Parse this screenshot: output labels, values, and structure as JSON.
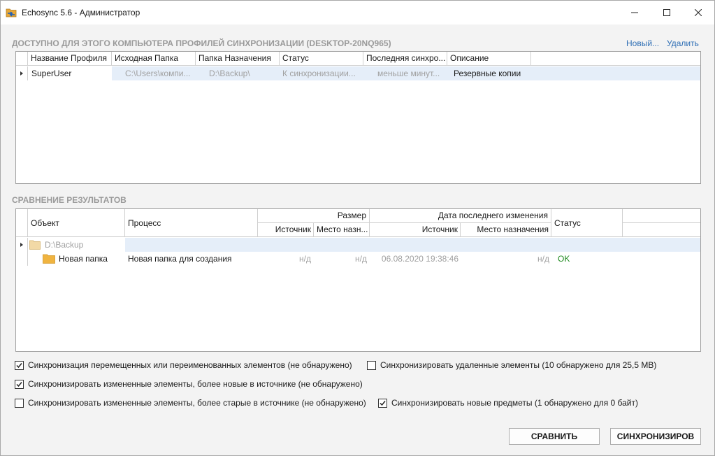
{
  "window": {
    "title": "Echosync 5.6 - Администратор"
  },
  "profiles": {
    "section_title": "ДОСТУПНО ДЛЯ ЭТОГО КОМПЬЮТЕРА ПРОФИЛЕЙ СИНХРОНИЗАЦИИ (DESKTOP-20NQ965)",
    "new_link": "Новый...",
    "delete_link": "Удалить",
    "columns": [
      "Название Профиля",
      "Исходная Папка",
      "Папка Назначения",
      "Статус",
      "Последняя синхро...",
      "Описание"
    ],
    "rows": [
      {
        "name": "SuperUser",
        "source": "C:\\Users\\компи...",
        "destination": "D:\\Backup\\",
        "status": "К синхронизации...",
        "last_sync": "меньше минут...",
        "description": "Резервные копии"
      }
    ]
  },
  "compare": {
    "section_title": "СРАВНЕНИЕ РЕЗУЛЬТАТОВ",
    "col_object": "Объект",
    "col_process": "Процесс",
    "col_size": "Размер",
    "col_date": "Дата последнего изменения",
    "col_status": "Статус",
    "sub_source": "Источник",
    "sub_dest_short": "Место назн...",
    "sub_source2": "Источник",
    "sub_dest": "Место назначения",
    "root_row": {
      "object": "D:\\Backup"
    },
    "rows": [
      {
        "object": "Новая папка",
        "process": "Новая папка для создания",
        "size_source": "н/д",
        "size_dest": "н/д",
        "date_source": "06.08.2020 19:38:46",
        "date_dest": "н/д",
        "status": "OK"
      }
    ]
  },
  "options": {
    "moved": {
      "label": "Синхронизация перемещенных или переименованных элементов (не обнаружено)",
      "checked": true
    },
    "deleted": {
      "label": "Синхронизировать удаленные элементы (10 обнаружено для 25,5 MB)",
      "checked": false
    },
    "newer": {
      "label": "Синхронизировать измененные элементы, более новые в источнике (не обнаружено)",
      "checked": true
    },
    "older": {
      "label": "Синхронизировать измененные элементы, более старые в источнике (не обнаружено)",
      "checked": false
    },
    "new_items": {
      "label": "Синхронизировать новые предметы (1 обнаружено для 0 байт)",
      "checked": true
    }
  },
  "buttons": {
    "compare": "СРАВНИТЬ",
    "sync": "СИНХРОНИЗИРОВ"
  },
  "colors": {
    "link": "#2f6fb5",
    "selected_row": "#e5eef9",
    "ok": "#1e8a1e",
    "section_title": "#9a9a9a"
  },
  "icons": {
    "app": "folder-sync-icon",
    "folder": "folder-icon",
    "expand": "expand-arrow-icon"
  }
}
